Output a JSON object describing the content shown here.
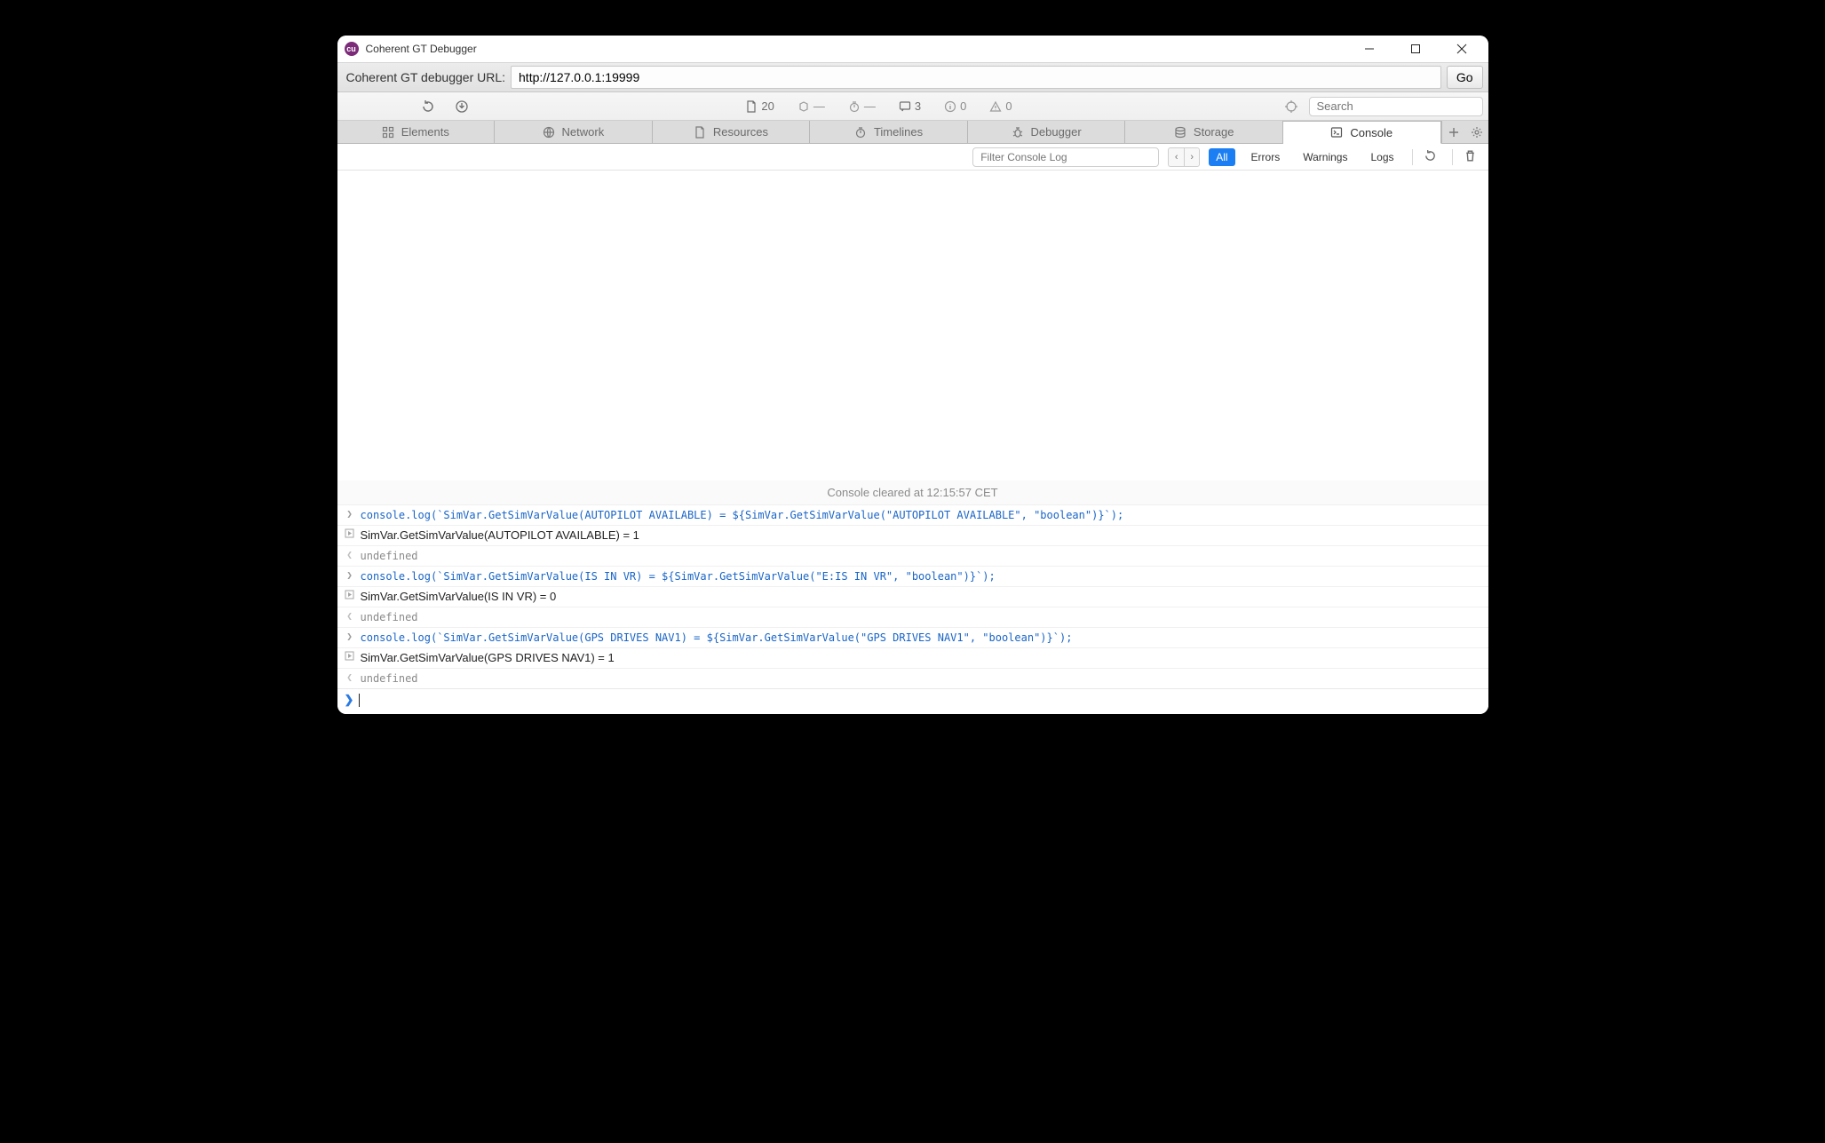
{
  "window": {
    "title": "Coherent GT Debugger"
  },
  "urlbar": {
    "label": "Coherent GT debugger URL:",
    "value": "http://127.0.0.1:19999",
    "go": "Go"
  },
  "metrics": {
    "docs": "20",
    "time_a": "—",
    "time_b": "—",
    "comments": "3",
    "info": "0",
    "warn": "0",
    "search_placeholder": "Search"
  },
  "tabs": {
    "items": [
      {
        "label": "Elements"
      },
      {
        "label": "Network"
      },
      {
        "label": "Resources"
      },
      {
        "label": "Timelines"
      },
      {
        "label": "Debugger"
      },
      {
        "label": "Storage"
      },
      {
        "label": "Console"
      }
    ],
    "active_index": 6
  },
  "filterbar": {
    "placeholder": "Filter Console Log",
    "all": "All",
    "errors": "Errors",
    "warnings": "Warnings",
    "logs": "Logs"
  },
  "console": {
    "cleared": "Console cleared at 12:15:57 CET",
    "entries": [
      {
        "kind": "input",
        "text": "console.log(`SimVar.GetSimVarValue(AUTOPILOT AVAILABLE) = ${SimVar.GetSimVarValue(\"AUTOPILOT AVAILABLE\", \"boolean\")}`);"
      },
      {
        "kind": "log",
        "text": "SimVar.GetSimVarValue(AUTOPILOT AVAILABLE) = 1"
      },
      {
        "kind": "return",
        "text": "undefined"
      },
      {
        "kind": "input",
        "text": "console.log(`SimVar.GetSimVarValue(IS IN VR) = ${SimVar.GetSimVarValue(\"E:IS IN VR\", \"boolean\")}`);"
      },
      {
        "kind": "log",
        "text": "SimVar.GetSimVarValue(IS IN VR) = 0"
      },
      {
        "kind": "return",
        "text": "undefined"
      },
      {
        "kind": "input",
        "text": "console.log(`SimVar.GetSimVarValue(GPS DRIVES NAV1) = ${SimVar.GetSimVarValue(\"GPS DRIVES NAV1\", \"boolean\")}`);"
      },
      {
        "kind": "log",
        "text": "SimVar.GetSimVarValue(GPS DRIVES NAV1) = 1"
      },
      {
        "kind": "return",
        "text": "undefined"
      }
    ]
  }
}
